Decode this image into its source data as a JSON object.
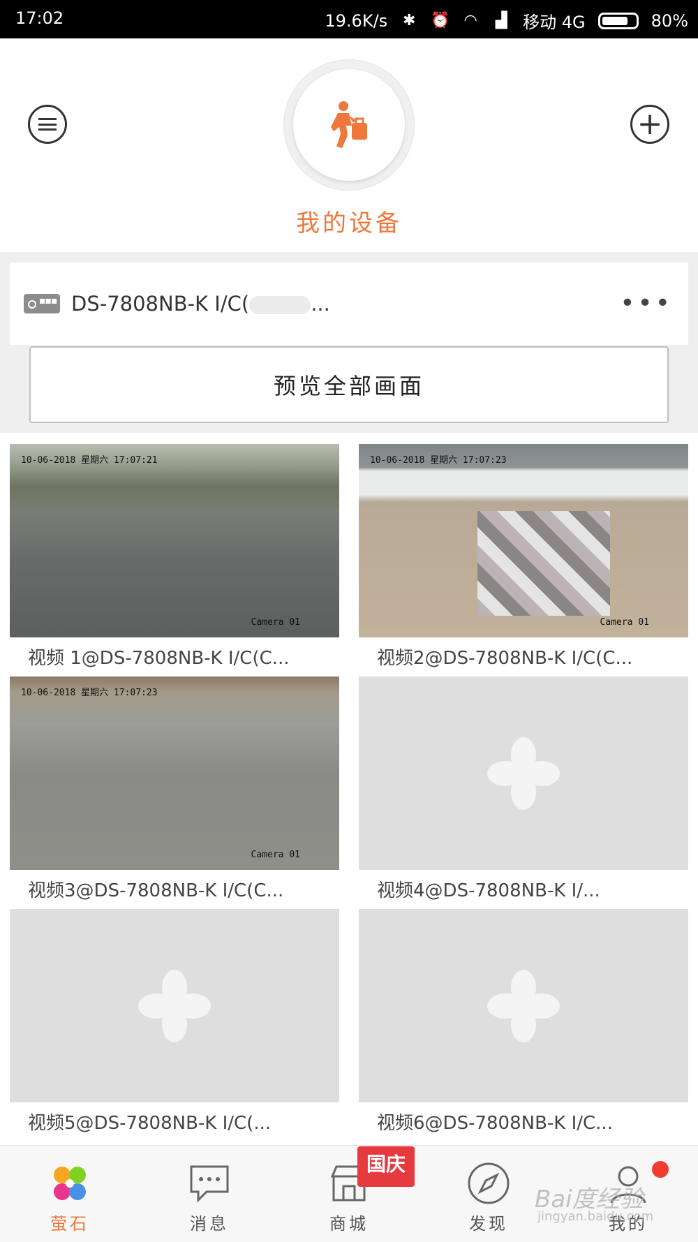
{
  "status_bar": {
    "time": "17:02",
    "speed": "19.6K/s",
    "network": "移动 4G",
    "battery": "80%",
    "battery_level": 0.8,
    "icons": [
      "bluetooth-icon",
      "alarm-icon",
      "wifi-icon",
      "signal-icon"
    ]
  },
  "header": {
    "title": "我的设备",
    "accent_color": "#f0773a"
  },
  "device": {
    "name": "DS-7808NB-K I/C(",
    "name_suffix": "..."
  },
  "preview_all_label": "预览全部画面",
  "channels": [
    {
      "caption": "视频 1@DS-7808NB-K I/C(C...",
      "osd_time": "10-06-2018 星期六 17:07:21",
      "osd_cam": "Camera 01",
      "has_video": true
    },
    {
      "caption": "视频2@DS-7808NB-K I/C(C...",
      "osd_time": "10-06-2018 星期六 17:07:23",
      "osd_cam": "Camera 01",
      "has_video": true
    },
    {
      "caption": "视频3@DS-7808NB-K I/C(C...",
      "osd_time": "10-06-2018 星期六 17:07:23",
      "osd_cam": "Camera 01",
      "has_video": true
    },
    {
      "caption": "视频4@DS-7808NB-K I/...",
      "has_video": false
    },
    {
      "caption": "视频5@DS-7808NB-K I/C(...",
      "has_video": false
    },
    {
      "caption": "视频6@DS-7808NB-K I/C...",
      "has_video": false
    }
  ],
  "tabs": [
    {
      "label": "萤石",
      "icon": "ezviz-logo-icon",
      "active": true
    },
    {
      "label": "消息",
      "icon": "message-icon",
      "active": false
    },
    {
      "label": "商城",
      "icon": "store-icon",
      "active": false
    },
    {
      "label": "发现",
      "icon": "compass-icon",
      "active": false
    },
    {
      "label": "我的",
      "icon": "user-icon",
      "active": false
    }
  ],
  "promo_tag": "国庆",
  "watermark": {
    "text": "Bai度经验",
    "url_text": "jingyan.baidu.com"
  }
}
